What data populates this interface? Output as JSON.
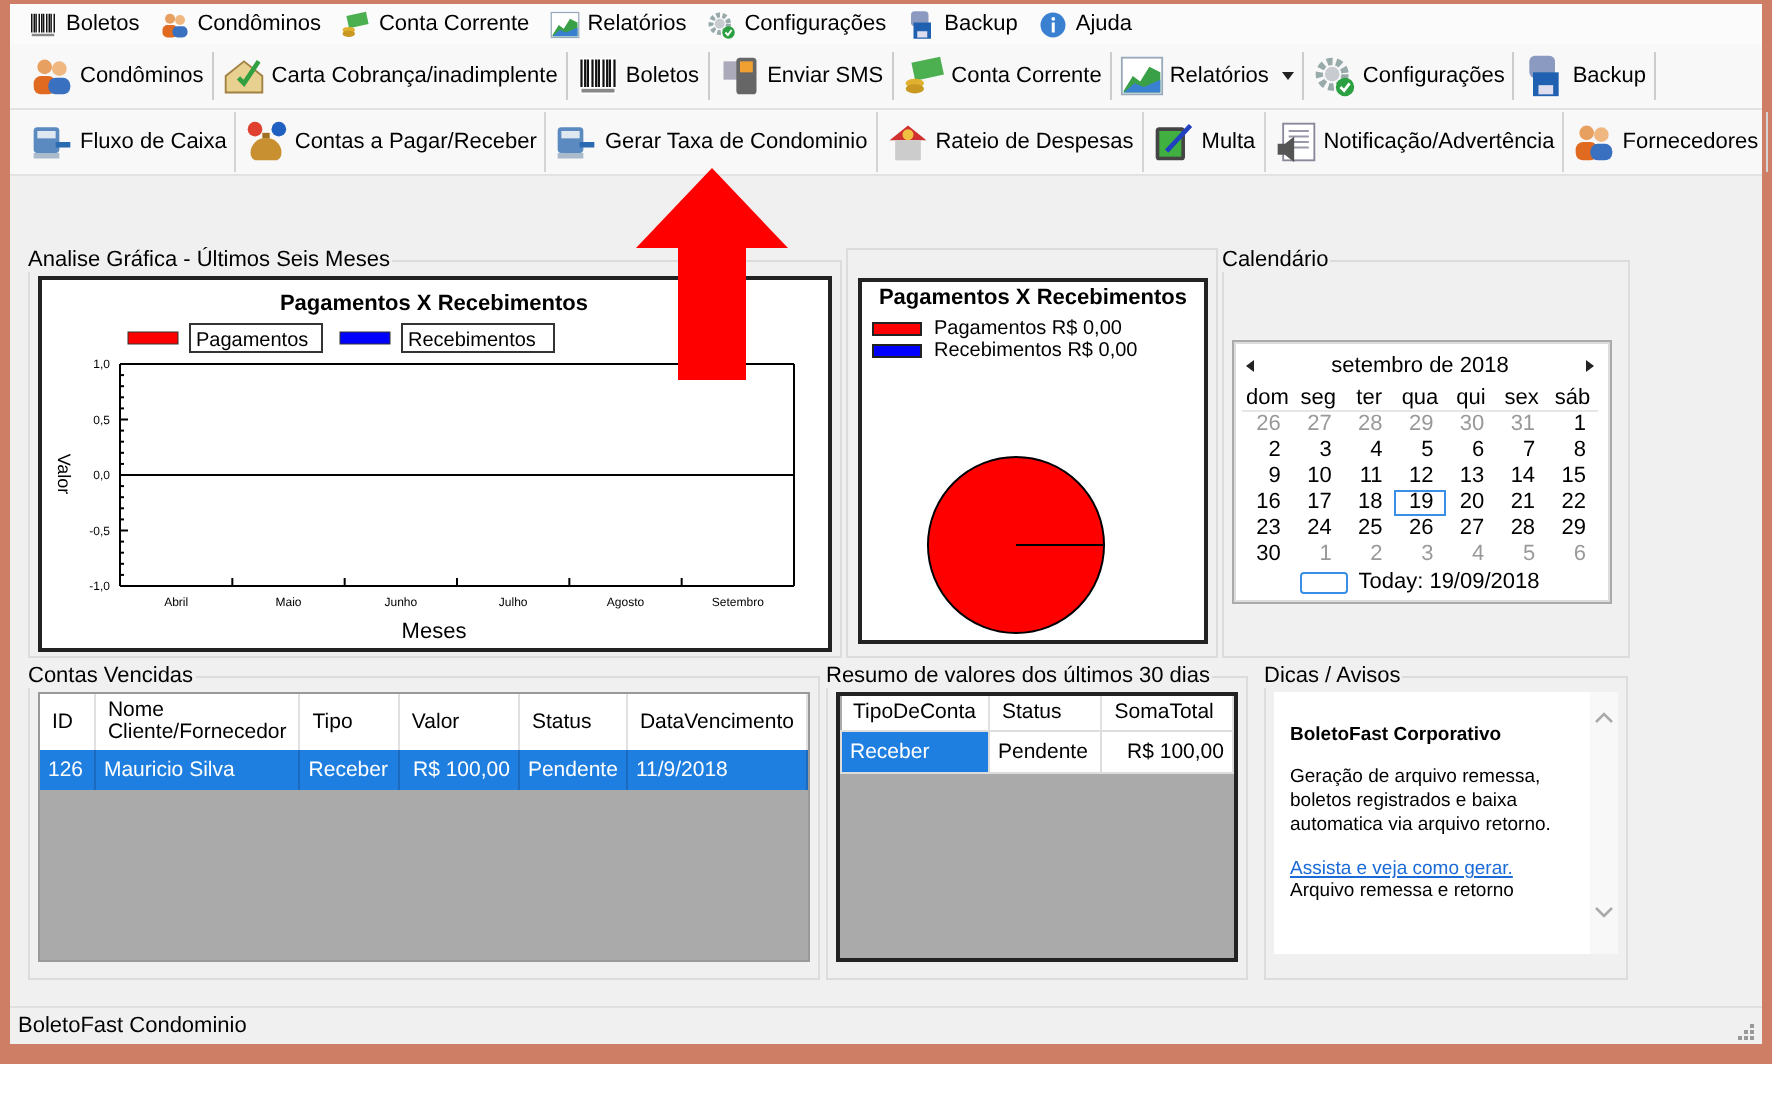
{
  "menu": [
    {
      "label": "Boletos"
    },
    {
      "label": "Condôminos"
    },
    {
      "label": "Conta Corrente"
    },
    {
      "label": "Relatórios"
    },
    {
      "label": "Configurações"
    },
    {
      "label": "Backup"
    },
    {
      "label": "Ajuda"
    }
  ],
  "toolbar_1": [
    {
      "label": "Condôminos",
      "kind": "button"
    },
    {
      "label": "Carta Cobrança/inadimplente",
      "kind": "button"
    },
    {
      "label": "Boletos",
      "kind": "button"
    },
    {
      "label": "Enviar SMS",
      "kind": "button"
    },
    {
      "label": "Conta Corrente",
      "kind": "button"
    },
    {
      "label": "Relatórios",
      "kind": "split"
    },
    {
      "label": "Configurações",
      "kind": "button"
    },
    {
      "label": "Backup",
      "kind": "button"
    }
  ],
  "toolbar_2": [
    {
      "label": "Fluxo de Caixa",
      "kind": "button"
    },
    {
      "label": "Contas a Pagar/Receber",
      "kind": "button"
    },
    {
      "label": "Gerar Taxa de Condominio",
      "kind": "button"
    },
    {
      "label": "Rateio de Despesas",
      "kind": "button"
    },
    {
      "label": "Multa",
      "kind": "button"
    },
    {
      "label": "Notificação/Advertência",
      "kind": "button"
    },
    {
      "label": "Fornecedores",
      "kind": "button"
    }
  ],
  "analysis": {
    "title": "Analise Gráfica - Últimos Seis Meses",
    "chart_data": {
      "type": "bar",
      "title": "Pagamentos  X Recebimentos",
      "xlabel": "Meses",
      "ylabel": "Valor",
      "categories": [
        "Abril",
        "Maio",
        "Junho",
        "Julho",
        "Agosto",
        "Setembro"
      ],
      "series": [
        {
          "name": "Pagamentos",
          "color": "#ff0000",
          "values": [
            null,
            null,
            null,
            null,
            null,
            null
          ]
        },
        {
          "name": "Recebimentos",
          "color": "#0000ff",
          "values": [
            null,
            null,
            null,
            null,
            null,
            null
          ]
        }
      ],
      "ylim": [
        -1,
        1
      ],
      "yticks": [
        {
          "value": 1,
          "label": "1,0"
        },
        {
          "value": 0.5,
          "label": "0,5"
        },
        {
          "value": 0,
          "label": "0,0"
        },
        {
          "value": -0.5,
          "label": "-0,5"
        },
        {
          "value": -1,
          "label": "-1,0"
        }
      ]
    }
  },
  "pie": {
    "title": "Pagamentos X Recebimentos",
    "legend": [
      {
        "label": "Pagamentos R$ 0,00",
        "color": "#ff0000"
      },
      {
        "label": "Recebimentos R$ 0,00",
        "color": "#0000ff"
      }
    ]
  },
  "calendar": {
    "title": "Calendário",
    "month": "setembro de 2018",
    "weekdays": [
      "dom",
      "seg",
      "ter",
      "qua",
      "qui",
      "sex",
      "sáb"
    ],
    "weeks": [
      [
        {
          "day": "26",
          "muted": true,
          "selected": false
        },
        {
          "day": "27",
          "muted": true,
          "selected": false
        },
        {
          "day": "28",
          "muted": true,
          "selected": false
        },
        {
          "day": "29",
          "muted": true,
          "selected": false
        },
        {
          "day": "30",
          "muted": true,
          "selected": false
        },
        {
          "day": "31",
          "muted": true,
          "selected": false
        },
        {
          "day": "1",
          "muted": false,
          "selected": false
        }
      ],
      [
        {
          "day": "2",
          "muted": false,
          "selected": false
        },
        {
          "day": "3",
          "muted": false,
          "selected": false
        },
        {
          "day": "4",
          "muted": false,
          "selected": false
        },
        {
          "day": "5",
          "muted": false,
          "selected": false
        },
        {
          "day": "6",
          "muted": false,
          "selected": false
        },
        {
          "day": "7",
          "muted": false,
          "selected": false
        },
        {
          "day": "8",
          "muted": false,
          "selected": false
        }
      ],
      [
        {
          "day": "9",
          "muted": false,
          "selected": false
        },
        {
          "day": "10",
          "muted": false,
          "selected": false
        },
        {
          "day": "11",
          "muted": false,
          "selected": false
        },
        {
          "day": "12",
          "muted": false,
          "selected": false
        },
        {
          "day": "13",
          "muted": false,
          "selected": false
        },
        {
          "day": "14",
          "muted": false,
          "selected": false
        },
        {
          "day": "15",
          "muted": false,
          "selected": false
        }
      ],
      [
        {
          "day": "16",
          "muted": false,
          "selected": false
        },
        {
          "day": "17",
          "muted": false,
          "selected": false
        },
        {
          "day": "18",
          "muted": false,
          "selected": false
        },
        {
          "day": "19",
          "muted": false,
          "selected": true
        },
        {
          "day": "20",
          "muted": false,
          "selected": false
        },
        {
          "day": "21",
          "muted": false,
          "selected": false
        },
        {
          "day": "22",
          "muted": false,
          "selected": false
        }
      ],
      [
        {
          "day": "23",
          "muted": false,
          "selected": false
        },
        {
          "day": "24",
          "muted": false,
          "selected": false
        },
        {
          "day": "25",
          "muted": false,
          "selected": false
        },
        {
          "day": "26",
          "muted": false,
          "selected": false
        },
        {
          "day": "27",
          "muted": false,
          "selected": false
        },
        {
          "day": "28",
          "muted": false,
          "selected": false
        },
        {
          "day": "29",
          "muted": false,
          "selected": false
        }
      ],
      [
        {
          "day": "30",
          "muted": false,
          "selected": false
        },
        {
          "day": "1",
          "muted": true,
          "selected": false
        },
        {
          "day": "2",
          "muted": true,
          "selected": false
        },
        {
          "day": "3",
          "muted": true,
          "selected": false
        },
        {
          "day": "4",
          "muted": true,
          "selected": false
        },
        {
          "day": "5",
          "muted": true,
          "selected": false
        },
        {
          "day": "6",
          "muted": true,
          "selected": false
        }
      ]
    ],
    "today": "Today: 19/09/2018"
  },
  "overdue": {
    "title": "Contas Vencidas",
    "columns": [
      "ID",
      "Nome Cliente/Fornecedor",
      "Tipo",
      "Valor",
      "Status",
      "DataVencimento"
    ],
    "rows": [
      {
        "selected": true,
        "cells": [
          "126",
          "Mauricio Silva",
          "Receber",
          "R$ 100,00",
          "Pendente",
          "11/9/2018"
        ]
      }
    ]
  },
  "summary": {
    "title": "Resumo de valores dos últimos 30 dias",
    "columns": [
      "TipoDeConta",
      "Status",
      "SomaTotal"
    ],
    "rows": [
      {
        "cells": [
          {
            "text": "Receber",
            "selected": true
          },
          {
            "text": "Pendente",
            "selected": false
          },
          {
            "text": "R$ 100,00",
            "selected": false
          }
        ]
      }
    ]
  },
  "tips": {
    "title": "Dicas / Avisos",
    "heading": "BoletoFast Corporativo",
    "text": "Geração de arquivo remessa, boletos registrados e baixa automatica via arquivo retorno.",
    "link": "Assista e veja como gerar.",
    "note": "Arquivo remessa e retorno"
  },
  "status_bar": "BoletoFast Condominio"
}
